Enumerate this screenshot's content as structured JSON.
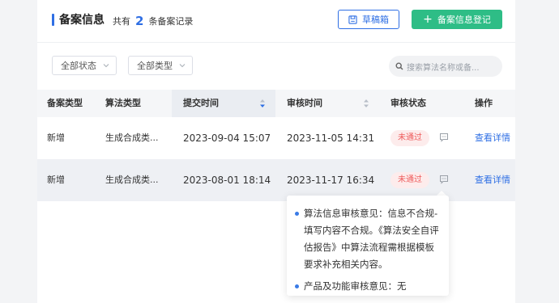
{
  "header": {
    "title": "备案信息",
    "count_prefix": "共有",
    "count": "2",
    "count_suffix": "条备案记录",
    "draft_button": "草稿箱",
    "register_button": "备案信息登记"
  },
  "filters": {
    "status_select": "全部状态",
    "type_select": "全部类型",
    "search_placeholder": "搜索算法名称或备..."
  },
  "table": {
    "columns": [
      "备案类型",
      "算法类型",
      "提交时间",
      "审核时间",
      "审核状态",
      "操作"
    ],
    "rows": [
      {
        "filing_type": "新增",
        "algo_type": "生成合成类...",
        "submit_time": "2023-09-04 15:07",
        "review_time": "2023-11-05 14:31",
        "status": "未通过",
        "action": "查看详情"
      },
      {
        "filing_type": "新增",
        "algo_type": "生成合成类...",
        "submit_time": "2023-08-01 18:14",
        "review_time": "2023-11-17 16:34",
        "status": "未通过",
        "action": "查看详情"
      }
    ]
  },
  "tooltip": {
    "items": [
      "算法信息审核意见：信息不合规-填写内容不合规。《算法安全自评估报告》中算法流程需根据模板要求补充相关内容。",
      "产品及功能审核意见：无"
    ]
  },
  "colors": {
    "accent": "#2f6fe4",
    "register_green": "#2ebd86",
    "status_red": "#ee5a5a"
  },
  "icons": [
    "draft-box-icon",
    "plus-icon",
    "chevron-down-icon",
    "search-icon",
    "sort-icon",
    "comment-icon"
  ]
}
